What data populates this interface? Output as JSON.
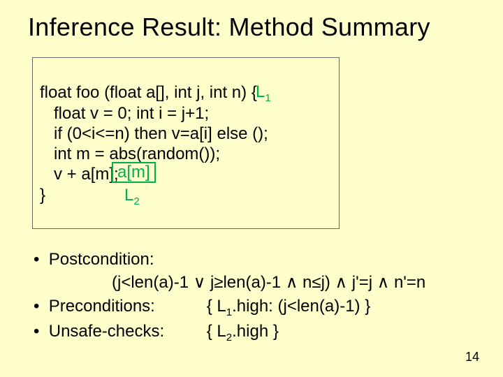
{
  "title": "Inference Result: Method Summary",
  "code": {
    "l1": "float foo (float a[], int j, int n) {",
    "l2": "   float v = 0; int i = j+1;",
    "l3": "   if (0<i<=n) then v=a[i] else ();",
    "l4": "   int m = abs(random());",
    "l5": "   v + a[m];",
    "l6": "}"
  },
  "labels": {
    "L1": "L",
    "L1sub": "1",
    "L2box": "a[m]",
    "L2": "L",
    "L2sub": "2"
  },
  "bullets": {
    "postcondition_label": "Postcondition:",
    "postcondition_expr": "(j<len(a)-1 ∨ j≥len(a)-1 ∧ n≤j) ∧ j'=j ∧ n'=n",
    "preconditions_label": "Preconditions:",
    "preconditions_pre": "{ L",
    "preconditions_sub": "1",
    "preconditions_post": ".high: (j<len(a)-1) }",
    "unsafe_label": "Unsafe-checks:",
    "unsafe_pre": "{ L",
    "unsafe_sub": "2",
    "unsafe_post": ".high }"
  },
  "page": "14"
}
